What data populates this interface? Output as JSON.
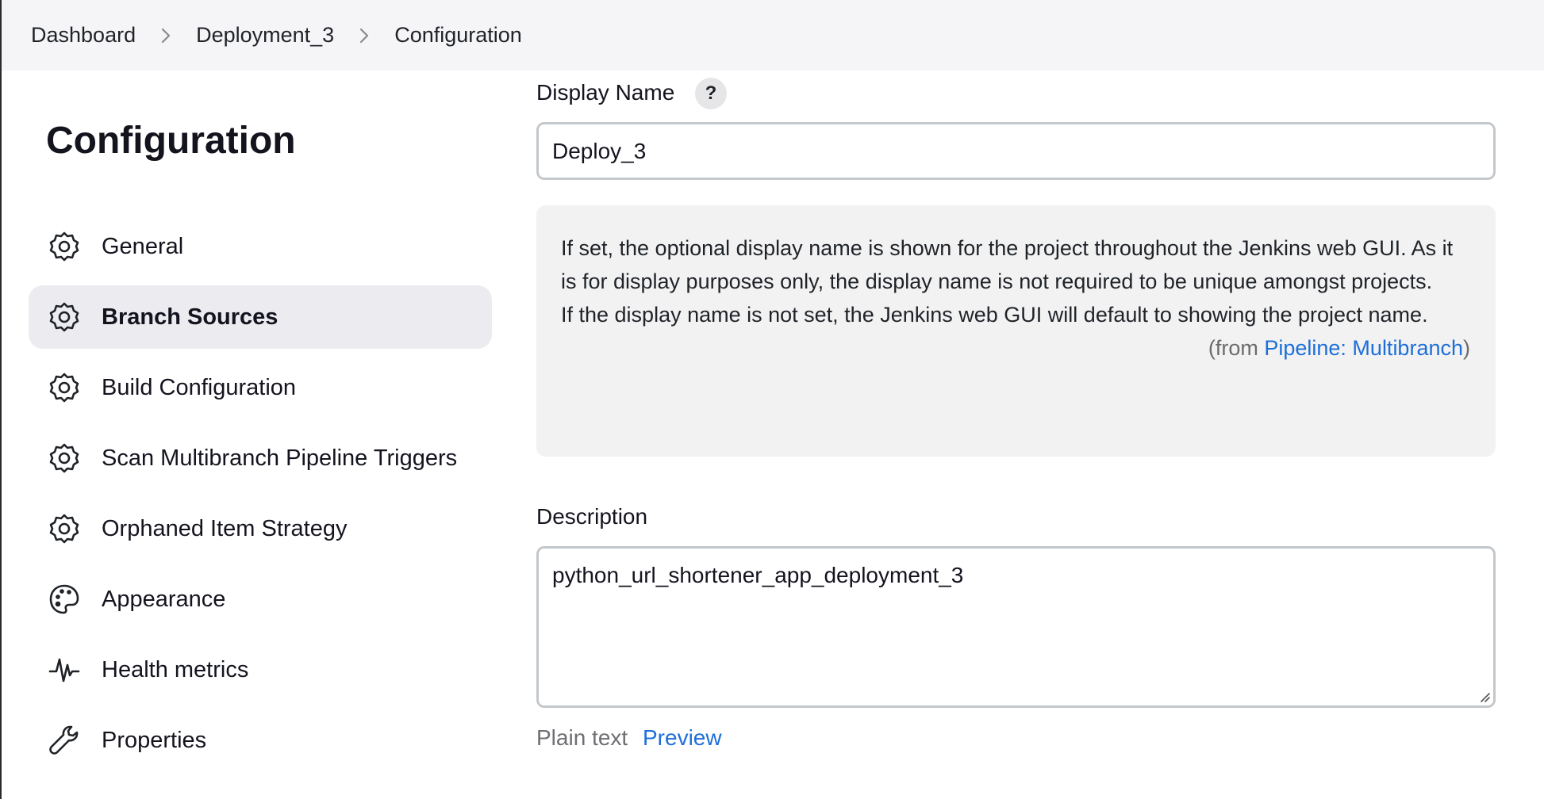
{
  "breadcrumb": {
    "items": [
      "Dashboard",
      "Deployment_3",
      "Configuration"
    ]
  },
  "sidebar": {
    "title": "Configuration",
    "items": [
      {
        "label": "General",
        "icon": "gear-icon"
      },
      {
        "label": "Branch Sources",
        "icon": "gear-icon",
        "active": true
      },
      {
        "label": "Build Configuration",
        "icon": "gear-icon"
      },
      {
        "label": "Scan Multibranch Pipeline Triggers",
        "icon": "gear-icon"
      },
      {
        "label": "Orphaned Item Strategy",
        "icon": "gear-icon"
      },
      {
        "label": "Appearance",
        "icon": "palette-icon"
      },
      {
        "label": "Health metrics",
        "icon": "pulse-icon"
      },
      {
        "label": "Properties",
        "icon": "wrench-icon"
      }
    ]
  },
  "display_name": {
    "label": "Display Name",
    "help_symbol": "?",
    "value": "Deploy_3",
    "help_text_1": "If set, the optional display name is shown for the project throughout the Jenkins web GUI. As it is for display purposes only, the display name is not required to be unique amongst projects.",
    "help_text_2": "If the display name is not set, the Jenkins web GUI will default to showing the project name.",
    "help_from_prefix": "(from ",
    "help_from_link": "Pipeline: Multibranch",
    "help_from_suffix": ")"
  },
  "description": {
    "label": "Description",
    "value": "python_url_shortener_app_deployment_3",
    "plain_text_label": "Plain text",
    "preview_label": "Preview"
  },
  "colors": {
    "link": "#1d6fd9",
    "active_item_bg": "#ececf0",
    "breadcrumb_bg": "#f5f5f7",
    "help_box_bg": "#f2f2f2"
  }
}
